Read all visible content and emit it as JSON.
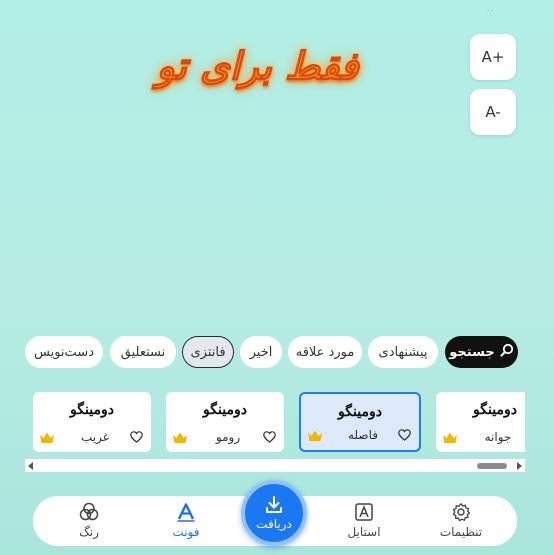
{
  "status_mark": "٠٠",
  "preview": {
    "text": "فقط برای تو"
  },
  "size_controls": {
    "increase": "A+",
    "decrease": "A-"
  },
  "categories": {
    "search_label": "جستجو",
    "chips": [
      {
        "label": "پیشنهادی",
        "active": false
      },
      {
        "label": "مورد علاقه",
        "active": false
      },
      {
        "label": "اخیر",
        "active": false
      },
      {
        "label": "فانتزی",
        "active": true
      },
      {
        "label": "نستعلیق",
        "active": false
      },
      {
        "label": "دست‌نویس",
        "active": false
      }
    ]
  },
  "fonts": [
    {
      "sample": "دومینگو",
      "name": "جوانه",
      "premium": true,
      "selected": false
    },
    {
      "sample": "دومینگو",
      "name": "فاصله",
      "premium": true,
      "selected": true
    },
    {
      "sample": "دومینگو",
      "name": "رومو",
      "premium": true,
      "selected": false
    },
    {
      "sample": "دومینگو",
      "name": "غریب",
      "premium": true,
      "selected": false
    }
  ],
  "bottom_nav": {
    "settings": "تنظیمات",
    "style": "استایل",
    "download": "دریافت",
    "font": "فونت",
    "color": "رنگ"
  },
  "colors": {
    "accent": "#1a78f2",
    "selected_card_bg": "#dde8f8",
    "crown": "#f4b400",
    "preview_text": "#f39a1b"
  }
}
